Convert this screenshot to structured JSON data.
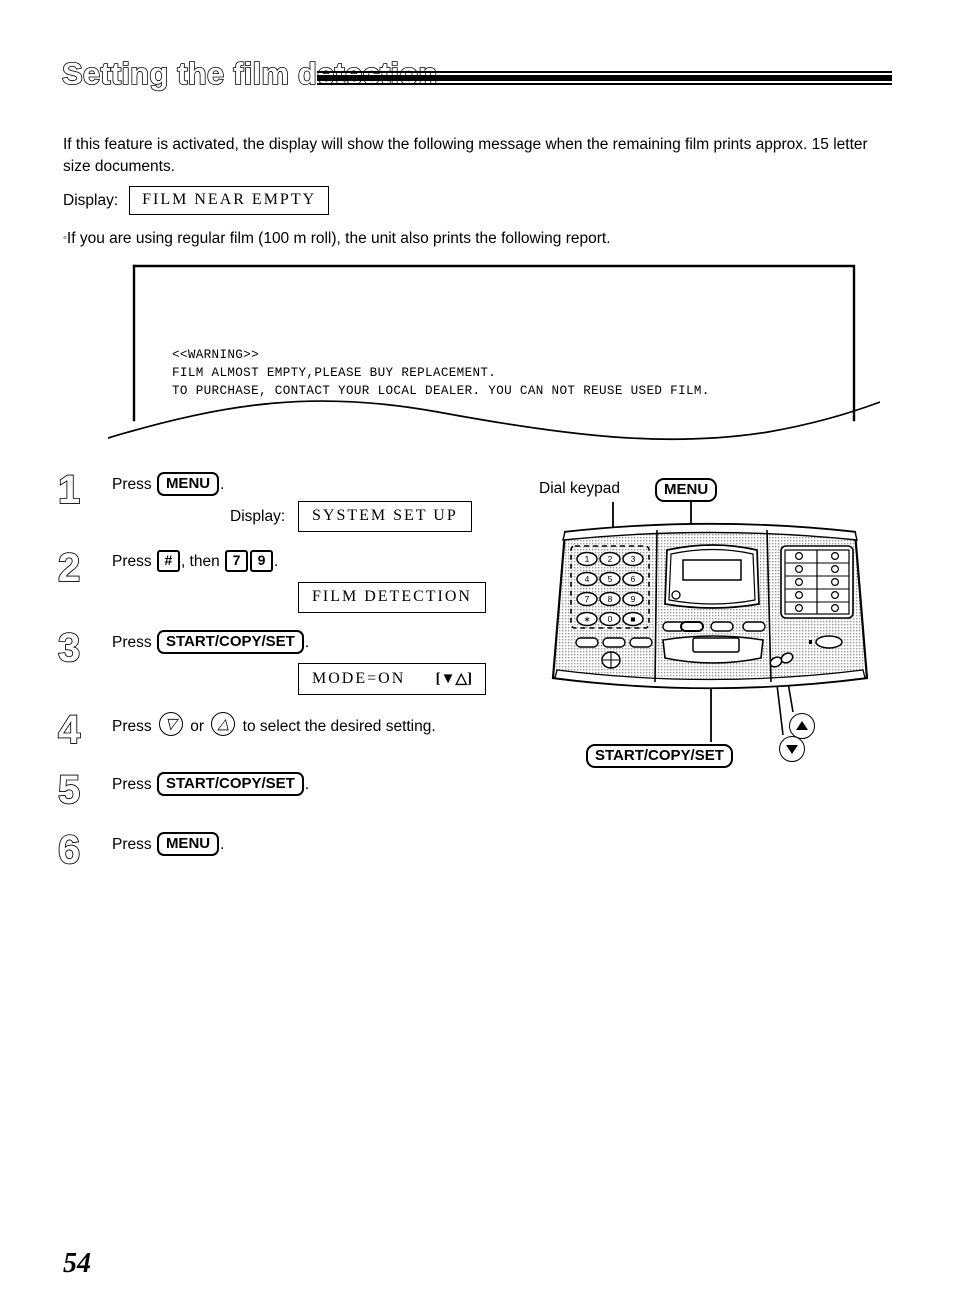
{
  "page": {
    "title": "Setting the film detection",
    "number": "54"
  },
  "intro": {
    "paragraph": "If this feature is activated, the display will show the following message when the remaining film prints approx. 15 letter size documents."
  },
  "display_example": {
    "label": "Display:",
    "value": "FILM NEAR EMPTY"
  },
  "note": {
    "bullet": "◦",
    "text": "If you are using regular film (100 m roll), the unit also prints the following report."
  },
  "report": {
    "lines": [
      "<<WARNING>>",
      "FILM ALMOST EMPTY,PLEASE BUY REPLACEMENT.",
      "TO PURCHASE, CONTACT YOUR LOCAL DEALER. YOU CAN NOT REUSE USED FILM."
    ]
  },
  "steps": [
    {
      "number": "1",
      "press_label": "Press",
      "key": "MENU",
      "period": ".",
      "display_label": "Display:",
      "display_value": "SYSTEM SET UP"
    },
    {
      "number": "2",
      "press_label": "Press",
      "key_hash": "#",
      "then_label": ", then",
      "key_7": "7",
      "key_9": "9",
      "period": ".",
      "display_value": "FILM DETECTION"
    },
    {
      "number": "3",
      "press_label": "Press",
      "key": "START/COPY/SET",
      "period": ".",
      "display_value": "MODE=ON",
      "display_arrows": "[▼△]"
    },
    {
      "number": "4",
      "press_label": "Press",
      "or_label": "or",
      "tail_label": "to select the desired setting.",
      "icon_down": "down-triangle-button",
      "icon_up": "up-triangle-button"
    },
    {
      "number": "5",
      "press_label": "Press",
      "key": "START/COPY/SET",
      "period": "."
    },
    {
      "number": "6",
      "press_label": "Press",
      "key": "MENU",
      "period": "."
    }
  ],
  "diagram": {
    "dial_keypad_label": "Dial keypad",
    "menu_callout": "MENU",
    "start_copy_set_callout": "START/COPY/SET",
    "keypad_rows": [
      [
        "1",
        "2",
        "3"
      ],
      [
        "4",
        "5",
        "6"
      ],
      [
        "7",
        "8",
        "9"
      ],
      [
        "∗",
        "0",
        "■"
      ]
    ],
    "down_button_icon": "down-triangle-button",
    "up_button_icon": "up-triangle-button"
  },
  "colors": {
    "ink": "#000000",
    "paper": "#ffffff",
    "panel_gray": "#d8d8d8"
  }
}
